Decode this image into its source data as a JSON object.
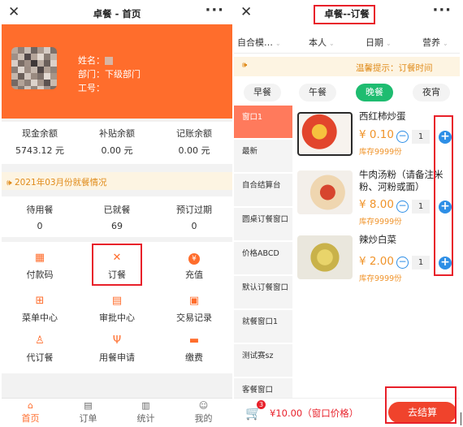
{
  "left": {
    "title": "卓餐 - 首页",
    "close_icon": "close-icon",
    "more_icon": "more-icon",
    "profile": {
      "name_label": "姓名：",
      "dept_label": "部门：",
      "dept_value": "下级部门",
      "id_label": "工号："
    },
    "balances": [
      {
        "label": "现金余额",
        "value": "5743.12 元"
      },
      {
        "label": "补贴余额",
        "value": "0.00 元"
      },
      {
        "label": "记账余额",
        "value": "0.00 元"
      }
    ],
    "notice": "2021年03月份就餐情况",
    "meal_stats": [
      {
        "label": "待用餐",
        "value": "0"
      },
      {
        "label": "已就餐",
        "value": "69"
      },
      {
        "label": "预订过期",
        "value": "0"
      }
    ],
    "menu": [
      {
        "label": "付款码",
        "icon": "qrcode-icon"
      },
      {
        "label": "订餐",
        "icon": "utensils-icon"
      },
      {
        "label": "充值",
        "icon": "money-bag-icon"
      },
      {
        "label": "菜单中心",
        "icon": "grid-icon"
      },
      {
        "label": "审批中心",
        "icon": "document-icon"
      },
      {
        "label": "交易记录",
        "icon": "receipt-icon"
      },
      {
        "label": "代订餐",
        "icon": "user-proxy-icon"
      },
      {
        "label": "用餐申请",
        "icon": "fork-knife-icon"
      },
      {
        "label": "缴费",
        "icon": "wallet-icon"
      }
    ],
    "tabs": [
      {
        "label": "首页",
        "icon": "home-icon"
      },
      {
        "label": "订单",
        "icon": "order-icon"
      },
      {
        "label": "统计",
        "icon": "chart-icon"
      },
      {
        "label": "我的",
        "icon": "user-icon"
      }
    ],
    "accent": "#ff6d2c"
  },
  "right": {
    "title": "卓餐--订餐",
    "filters": [
      "自合模…",
      "本人",
      "日期",
      "营养"
    ],
    "notice": "温馨提示：订餐时间",
    "segments": [
      "早餐",
      "午餐",
      "晚餐",
      "夜宵"
    ],
    "active_segment": "晚餐",
    "windows": [
      "窗口1",
      "最新",
      "自合结算台",
      "圆桌订餐窗口",
      "价格ABCD",
      "默认订餐窗口",
      "就餐窗口1",
      "测试赛sz",
      "客餐窗口"
    ],
    "active_window": "窗口1",
    "dishes": [
      {
        "name": "西红柿炒蛋",
        "price": "¥ 0.10",
        "stock": "库存9999份",
        "qty": "1"
      },
      {
        "name": "牛肉汤粉（请备注米粉、河粉或面）",
        "price": "¥ 8.00",
        "stock": "库存9999份",
        "qty": "1"
      },
      {
        "name": "辣炒白菜",
        "price": "¥ 2.00",
        "stock": "库存9999份",
        "qty": "1"
      }
    ],
    "cart_count": "3",
    "total": "¥10.00（窗口价格）",
    "checkout": "去结算",
    "primary_color": "#1ebc70",
    "link_color": "#2e8fe6"
  }
}
